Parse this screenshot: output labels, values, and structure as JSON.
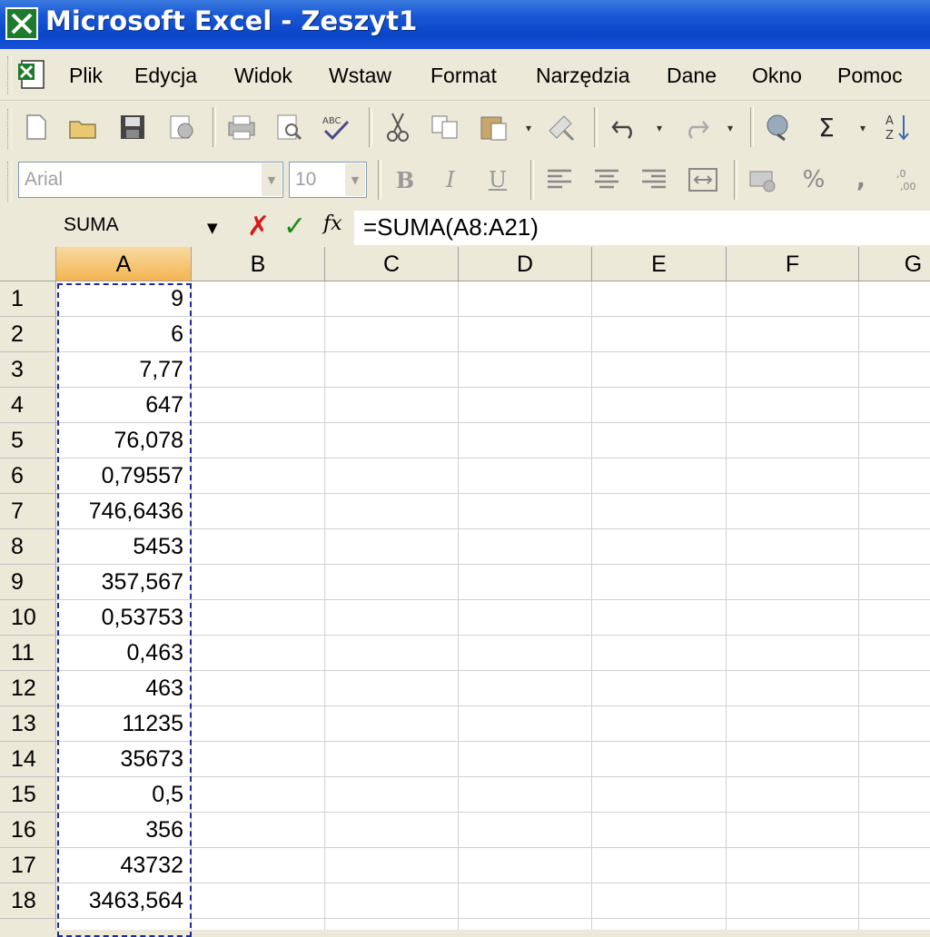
{
  "window": {
    "title": "Microsoft Excel - Zeszyt1"
  },
  "menu": [
    "Plik",
    "Edycja",
    "Widok",
    "Wstaw",
    "Format",
    "Narzędzia",
    "Dane",
    "Okno",
    "Pomoc"
  ],
  "toolbar": {
    "font_name": "Arial",
    "font_size": "10",
    "autosum_symbol": "Σ",
    "percent_symbol": "%",
    "comma_symbol": ","
  },
  "formula_bar": {
    "name_box": "SUMA",
    "fx_label": "fx",
    "formula": "=SUMA(A8:A21)"
  },
  "sheet": {
    "columns": [
      "A",
      "B",
      "C",
      "D",
      "E",
      "F",
      "G"
    ],
    "rows": [
      {
        "n": "1",
        "a": "9"
      },
      {
        "n": "2",
        "a": "6"
      },
      {
        "n": "3",
        "a": "7,77"
      },
      {
        "n": "4",
        "a": "647"
      },
      {
        "n": "5",
        "a": "76,078"
      },
      {
        "n": "6",
        "a": "0,79557"
      },
      {
        "n": "7",
        "a": "746,6436"
      },
      {
        "n": "8",
        "a": "5453"
      },
      {
        "n": "9",
        "a": "357,567"
      },
      {
        "n": "10",
        "a": "0,53753"
      },
      {
        "n": "11",
        "a": "0,463"
      },
      {
        "n": "12",
        "a": "463"
      },
      {
        "n": "13",
        "a": "11235"
      },
      {
        "n": "14",
        "a": "35673"
      },
      {
        "n": "15",
        "a": "0,5"
      },
      {
        "n": "16",
        "a": "356"
      },
      {
        "n": "17",
        "a": "43732"
      },
      {
        "n": "18",
        "a": "3463,564"
      }
    ],
    "active_column": "A",
    "colors": {
      "active_header": "#f3b552",
      "marquee": "#1a2a9a"
    }
  }
}
